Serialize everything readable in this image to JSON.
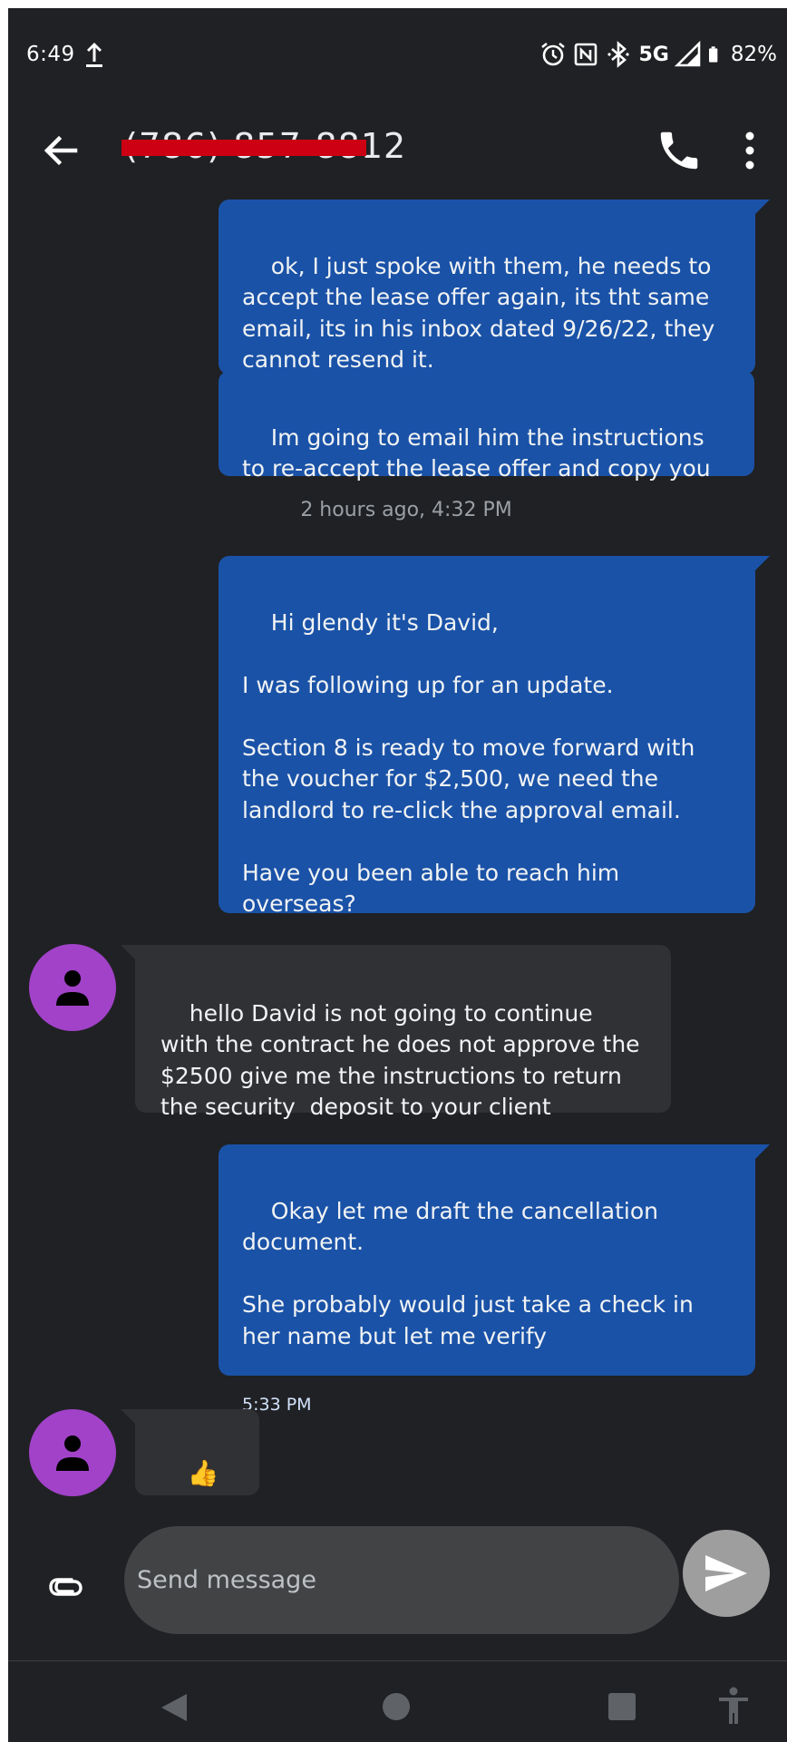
{
  "status_bar": {
    "time": "6:49",
    "network": "5G",
    "battery": "82%",
    "icons": [
      "upload-icon",
      "alarm-icon",
      "nfc-icon",
      "bluetooth-icon",
      "signal-icon",
      "battery-icon"
    ]
  },
  "header": {
    "contact": "(786) 857-8812",
    "icons": [
      "back-arrow-icon",
      "phone-icon",
      "more-vert-icon"
    ]
  },
  "messages": [
    {
      "direction": "outgoing",
      "text": "ok, I just spoke with them, he needs to accept the lease offer again, its tht same email, its in his inbox dated 9/26/22, they cannot resend it."
    },
    {
      "direction": "outgoing",
      "text": "Im going to email him the instructions to re-accept the lease offer and copy you"
    },
    {
      "type": "timestamp",
      "text": "2 hours ago, 4:32 PM"
    },
    {
      "direction": "outgoing",
      "text": "Hi glendy it's David,\n\nI was following up for an update.\n\nSection 8 is ready to move forward with the voucher for $2,500, we need the landlord to re-click the approval email.\n\nHave you been able to reach him overseas?"
    },
    {
      "direction": "incoming",
      "text": "hello David is not going to continue with the contract he does not approve the $2500 give me the instructions to return the security  deposit to your client"
    },
    {
      "direction": "outgoing",
      "text": "Okay let me draft the cancellation document.\n\nShe probably would just take a check in her name but let me verify",
      "time": "5:33 PM"
    },
    {
      "direction": "incoming",
      "text": "👍"
    }
  ],
  "compose": {
    "placeholder": "Send message",
    "icons": [
      "attach-icon",
      "send-icon"
    ]
  },
  "nav_bar": {
    "icons": [
      "nav-back-icon",
      "nav-home-icon",
      "nav-recents-icon",
      "accessibility-icon"
    ]
  },
  "colors": {
    "background": "#202124",
    "outgoing_bubble": "#1a52a7",
    "incoming_bubble": "#303134",
    "avatar": "#a142c9",
    "redaction": "#cc0012",
    "compose_field": "#424345",
    "send_button": "#9e9e9e"
  }
}
